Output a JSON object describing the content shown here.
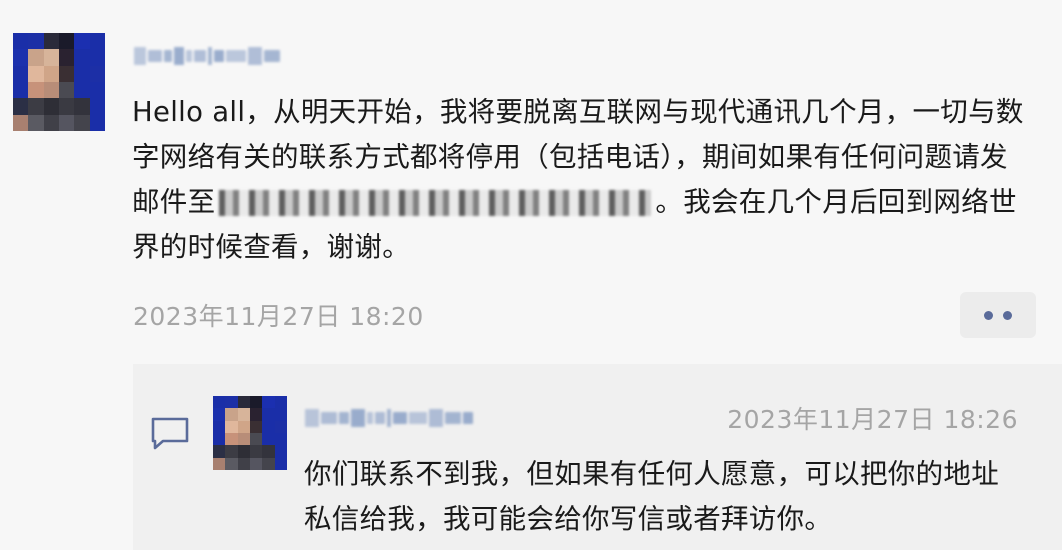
{
  "post": {
    "author_name": "",
    "text_part1": "Hello all，从明天开始，我将要脱离互联网与现代通讯几个月，一切与数字网络有关的联系方式都将停用（包括电话），期间如果有任何问题请发邮件至",
    "text_part2": "。我会在几个月后回到网络世界的时候查看，谢谢。",
    "timestamp": "2023年11月27日 18:20"
  },
  "reply": {
    "author_name": "",
    "timestamp": "2023年11月27日 18:26",
    "text": "你们联系不到我，但如果有任何人愿意，可以把你的地址私信给我，我可能会给你写信或者拜访你。"
  },
  "icons": {
    "more": "more-dots-icon",
    "comment": "comment-bubble-icon"
  },
  "colors": {
    "background": "#f7f7f7",
    "reply_background": "#f0f0f0",
    "timestamp": "#a5a5a5",
    "accent": "#5a6b9a"
  }
}
